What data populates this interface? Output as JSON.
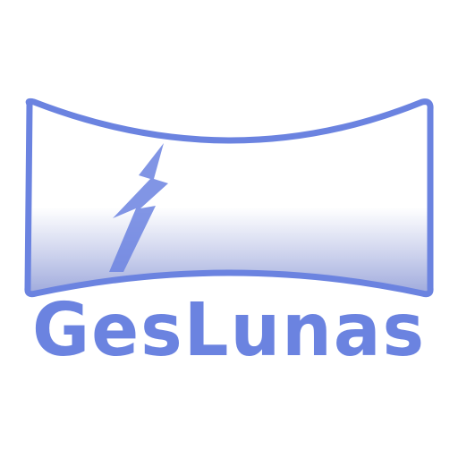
{
  "logo": {
    "wordmark": "GesLunas",
    "icon": "curved-glass-panel-with-crack-icon",
    "colors": {
      "outline": "#6b83e0",
      "panel_top": "#ffffff",
      "panel_bottom": "#9ea9dc",
      "crack": "#6b83e0",
      "text": "#6b83e0",
      "background": "#ffffff"
    }
  }
}
